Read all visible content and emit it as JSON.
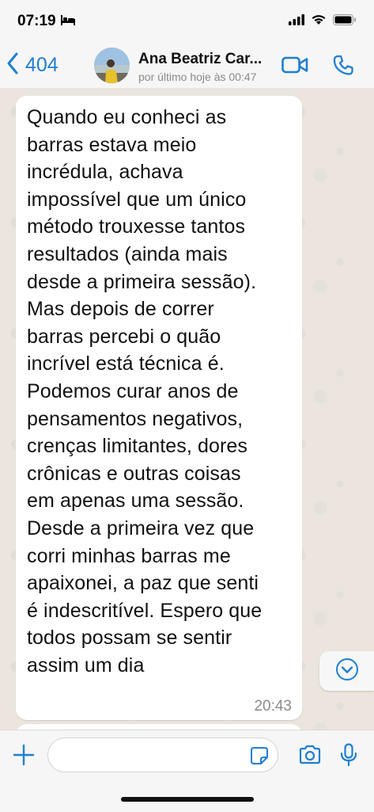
{
  "status_bar": {
    "time": "07:19",
    "icons": [
      "bed-icon",
      "signal-icon",
      "wifi-icon",
      "battery-icon"
    ]
  },
  "header": {
    "back_count": "404",
    "contact_name": "Ana Beatriz Car...",
    "contact_status": "por último hoje às 00:47",
    "icons": [
      "chevron-left-icon",
      "video-call-icon",
      "phone-icon"
    ],
    "accent_color": "#1f7fd1"
  },
  "chat": {
    "message": {
      "text": "Quando eu conheci as\nbarras estava meio\nincrédula, achava\nimpossível que um único\nmétodo trouxesse tantos\nresultados (ainda mais\ndesde a primeira sessão).\nMas depois de correr\nbarras percebi o quão\nincrível está técnica é.\nPodemos curar anos de\npensamentos negativos,\ncrenças limitantes, dores\ncrônicas e outras coisas\nem apenas uma sessão.\nDesde a primeira vez que\ncorri minhas barras me\napaixonei, a paz que senti\né indescritível. Espero que\ntodos possam se sentir\nassim um dia",
      "time": "20:43"
    },
    "background_color": "#ebe5de",
    "bubble_color": "#ffffff"
  },
  "input_bar": {
    "placeholder": "",
    "icons": [
      "plus-icon",
      "sticker-icon",
      "camera-icon",
      "microphone-icon"
    ]
  }
}
